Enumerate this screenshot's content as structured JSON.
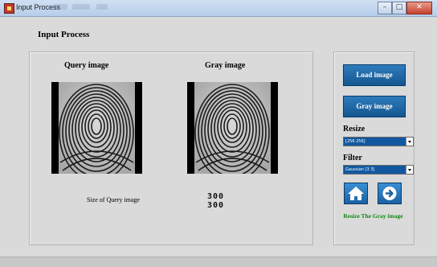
{
  "window": {
    "title": "Input Process"
  },
  "main": {
    "heading": "Input Process",
    "query_title": "Query image",
    "gray_title": "Gray image",
    "size_label": "Size of Query image",
    "size_values": [
      "300",
      "300"
    ]
  },
  "side": {
    "load_button": "Load image",
    "gray_button": "Gray image",
    "resize_label": "Resize",
    "resize_value": "[256 256]",
    "filter_label": "Filter",
    "filter_value": "Gaussian [3 3]",
    "status_text": "Resize The Gray image"
  },
  "icons": {
    "home": "home-icon",
    "next": "arrow-right-icon"
  },
  "colors": {
    "button_blue": "#1f6aaa",
    "status_green": "#0d8a10",
    "dropdown_blue": "#1258a0"
  }
}
